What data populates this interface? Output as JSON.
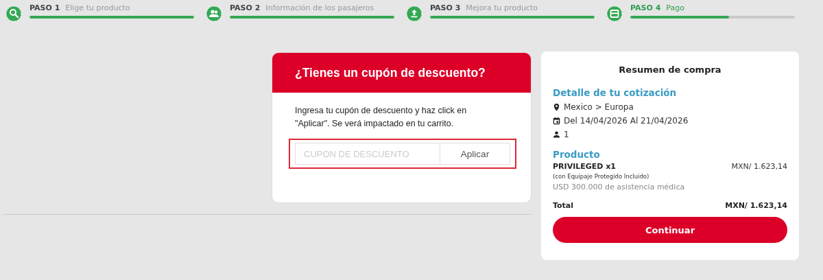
{
  "steps": [
    {
      "kind": "search",
      "number": "PASO 1",
      "label": "Elige tu producto",
      "selected": false,
      "level": 1
    },
    {
      "kind": "people",
      "number": "PASO 2",
      "label": "Información de los pasajeros",
      "selected": false,
      "level": 1
    },
    {
      "kind": "upload",
      "number": "PASO 3",
      "label": "Mejora tu producto",
      "selected": false,
      "level": 1
    },
    {
      "kind": "card",
      "number": "PASO 4",
      "label": "Pago",
      "selected": true,
      "level": 0.6
    }
  ],
  "coupon": {
    "title": "¿Tienes un cupón de descuento?",
    "text": "Ingresa tu cupón de descuento y haz click en \"Aplicar\". Se verá impactado en tu carrito.",
    "placeholder": "CUPON DE DESCUENTO",
    "button": "Aplicar"
  },
  "summary": {
    "title": "Resumen de compra",
    "details_heading": "Detalle de tu cotización",
    "details": [
      {
        "kind": "pin",
        "text": "Mexico > Europa"
      },
      {
        "kind": "calendar",
        "text": "Del 14/04/2026 Al 21/04/2026"
      },
      {
        "kind": "person",
        "text": "1"
      }
    ],
    "product_heading": "Producto",
    "product": {
      "name": "PRIVILEGED x1",
      "note": "(con Equipaje Protegido Incluido)",
      "coverage": "USD 300.000 de asistencia médica",
      "price": "MXN/ 1.623,14"
    },
    "total_label": "Total",
    "total": "MXN/ 1.623,14",
    "button": "Continuar"
  }
}
